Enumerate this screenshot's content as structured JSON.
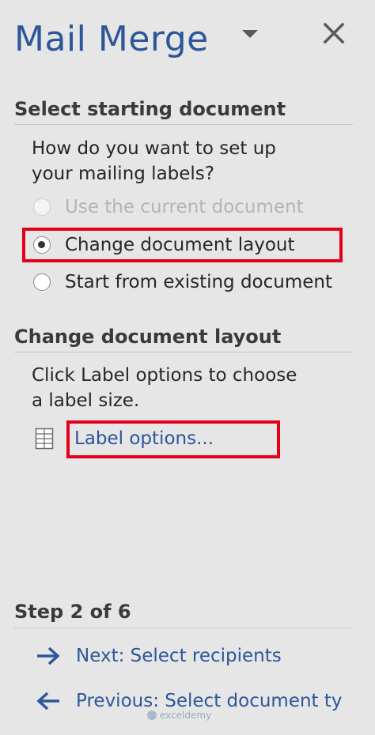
{
  "pane": {
    "title": "Mail Merge"
  },
  "section1": {
    "heading": "Select starting document",
    "question_line1": "How do you want to set up",
    "question_line2": "your mailing labels?",
    "options": [
      {
        "label": "Use the current document",
        "selected": false,
        "disabled": true
      },
      {
        "label": "Change document layout",
        "selected": true,
        "disabled": false
      },
      {
        "label": "Start from existing document",
        "selected": false,
        "disabled": false
      }
    ]
  },
  "section2": {
    "heading": "Change document layout",
    "instruction_line1": "Click Label options to choose",
    "instruction_line2": "a label size.",
    "link_label": "Label options..."
  },
  "footer": {
    "step": "Step 2 of 6",
    "next_label": "Next: Select recipients",
    "previous_label": "Previous: Select document ty"
  },
  "watermark": {
    "text": "exceldemy"
  },
  "colors": {
    "accent": "#2b579a",
    "highlight": "#e3001b",
    "panel_bg": "#e6e6e6"
  },
  "icons": {
    "menu": "chevron-down-icon",
    "close": "close-icon",
    "label_options": "document-table-icon",
    "next": "arrow-right-icon",
    "previous": "arrow-left-icon"
  }
}
